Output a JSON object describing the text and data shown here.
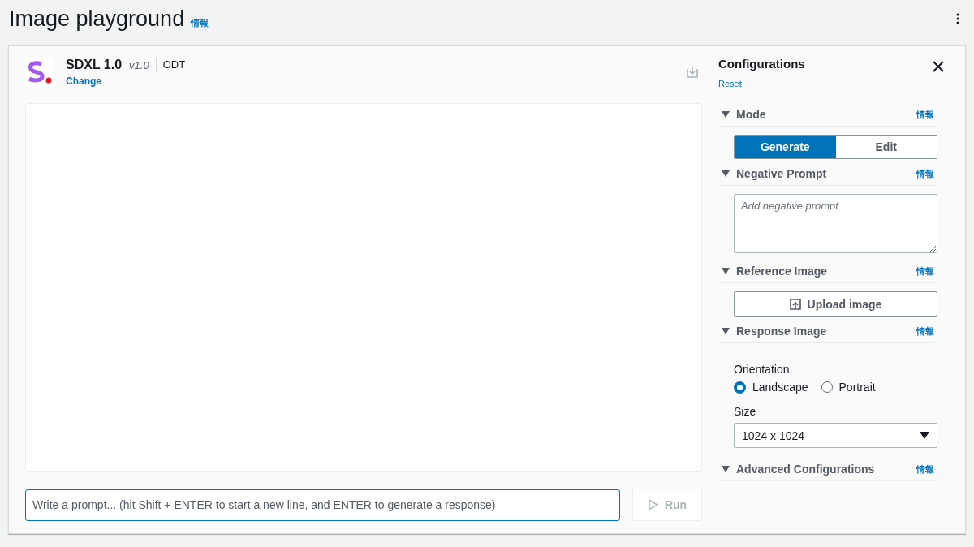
{
  "page": {
    "title": "Image playground",
    "info": "情報"
  },
  "model": {
    "name": "SDXL 1.0",
    "version": "v1.0",
    "badge": "ODT",
    "change": "Change"
  },
  "prompt": {
    "placeholder": "Write a prompt... (hit Shift + ENTER to start a new line, and ENTER to generate a response)",
    "run": "Run",
    "run_disabled": true
  },
  "config": {
    "title": "Configurations",
    "reset": "Reset",
    "sections": [
      {
        "kind": "segmented",
        "title": "Mode",
        "info": "情報",
        "options": [
          {
            "label": "Generate",
            "selected": true
          },
          {
            "label": "Edit",
            "selected": false
          }
        ]
      },
      {
        "kind": "textarea",
        "title": "Negative Prompt",
        "info": "情報",
        "placeholder": "Add negative prompt"
      },
      {
        "kind": "upload",
        "title": "Reference Image",
        "info": "情報",
        "button": "Upload image"
      },
      {
        "kind": "response",
        "title": "Response Image",
        "info": "情報",
        "orientation_label": "Orientation",
        "options": [
          {
            "label": "Landscape",
            "selected": true
          },
          {
            "label": "Portrait",
            "selected": false
          }
        ],
        "size_label": "Size",
        "size_value": "1024 x 1024"
      },
      {
        "kind": "plain",
        "title": "Advanced Configurations",
        "info": "情報"
      }
    ]
  }
}
